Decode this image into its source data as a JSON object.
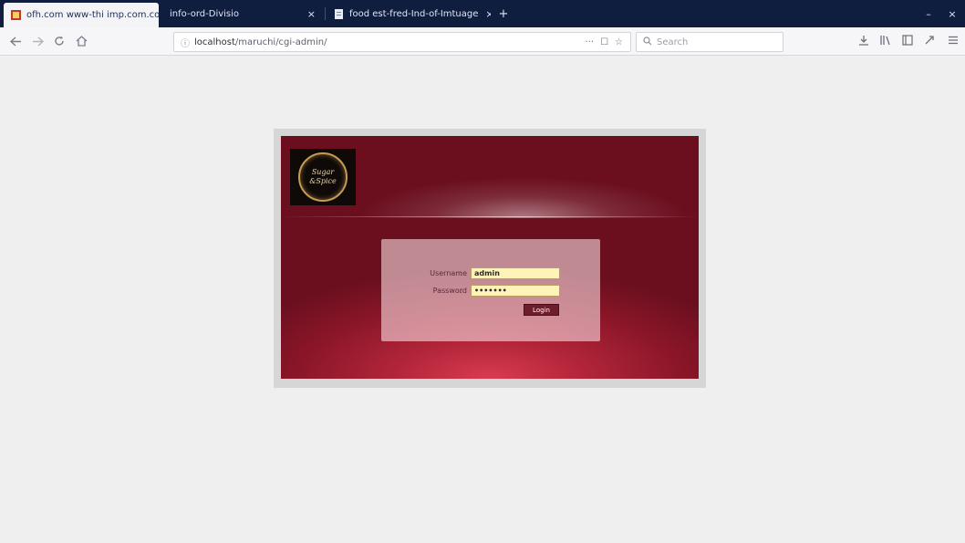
{
  "browser": {
    "tabs": [
      {
        "label": "ofh.com www-thi imp.com.com",
        "active": true
      },
      {
        "label": "info-ord-Divisio",
        "active": false
      },
      {
        "label": "food est-fred-Ind-of-Imtuage",
        "active": false
      }
    ],
    "close_glyph": "×",
    "new_tab_glyph": "+",
    "window_controls": {
      "minimize": "–",
      "close": "×"
    }
  },
  "nav": {
    "url_host": "localhost",
    "url_path": "/maruchi/cgi-admin/",
    "actions": [
      "···",
      "☐",
      "☆"
    ],
    "search_placeholder": "Search",
    "toolbar_icons": [
      "download-icon",
      "library-icon",
      "sidebar-icon",
      "extension-icon",
      "menu-icon"
    ]
  },
  "login": {
    "logo_line1": "Sugar",
    "logo_line2": "&Spice",
    "username_label": "Username",
    "password_label": "Password",
    "colon": ":",
    "username_value": "admin",
    "password_value": "•••••••",
    "submit_label": "Login"
  },
  "colors": {
    "tabbar": "#0f1e3f",
    "panel_dark": "#6b0f1f",
    "panel_light": "#d93b52",
    "input_bg": "#fff3b8",
    "button": "#6e1d2c"
  }
}
